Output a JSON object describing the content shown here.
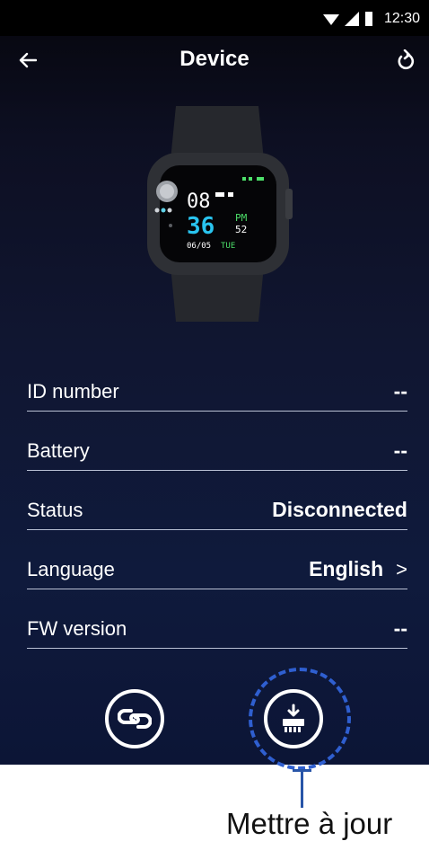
{
  "status_bar": {
    "time": "12:30",
    "wifi_icon": "wifi-icon",
    "signal_icon": "cell-signal-icon",
    "battery_icon": "battery-icon"
  },
  "app_bar": {
    "title": "Device",
    "back_icon": "back-arrow-icon",
    "refresh_icon": "refresh-icon"
  },
  "watch_face": {
    "hour": "08",
    "minute": "36",
    "ampm": "PM",
    "seconds": "52",
    "date": "06/05",
    "weekday": "TUE"
  },
  "info_rows": [
    {
      "label": "ID number",
      "value": "--"
    },
    {
      "label": "Battery",
      "value": "--"
    },
    {
      "label": "Status",
      "value": "Disconnected"
    },
    {
      "label": "Language",
      "value": "English",
      "chevron": ">"
    },
    {
      "label": "FW version",
      "value": "--"
    }
  ],
  "bottom_actions": {
    "sync_icon": "link-sync-icon",
    "update_icon": "firmware-update-icon"
  },
  "callout": {
    "text": "Mettre à jour"
  },
  "colors": {
    "background_top": "#06060c",
    "background_bottom": "#0f1a3c",
    "highlight": "#2f5fd0",
    "divider": "#b9c0d4"
  }
}
